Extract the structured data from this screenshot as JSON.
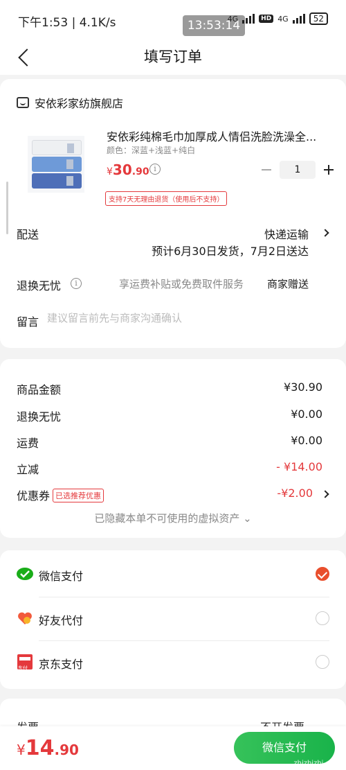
{
  "status_bar": {
    "time": "下午1:53 | 4.1K/s",
    "clock_overlay": "13:53:14",
    "network1": "4G",
    "hd": "HD",
    "network2": "4G",
    "battery": "52"
  },
  "nav": {
    "title": "填写订单"
  },
  "shop": {
    "name": "安依彩家纺旗舰店"
  },
  "product": {
    "title": "安依彩纯棉毛巾加厚成人情侣洗脸洗澡全...",
    "spec": "颜色：深蓝+浅蓝+纯白",
    "price_currency": "¥",
    "price_int": "30",
    "price_dec": ".90",
    "quantity": "1",
    "return_policy": "支持7天无理由退货（使用后不支持）"
  },
  "delivery": {
    "label": "配送",
    "method": "快递运输",
    "estimate": "预计6月30日发货，7月2日送达"
  },
  "hassle_free": {
    "label": "退换无忧",
    "description": "享运费补贴或免费取件服务",
    "gift": "商家赠送"
  },
  "remark": {
    "label": "留言",
    "placeholder": "建议留言前先与商家沟通确认"
  },
  "summary": {
    "goods_label": "商品金额",
    "goods_value": "¥30.90",
    "hassle_label": "退换无忧",
    "hassle_value": "¥0.00",
    "shipping_label": "运费",
    "shipping_value": "¥0.00",
    "discount_label": "立减",
    "discount_value": "- ¥14.00",
    "coupon_label": "优惠券",
    "coupon_badge": "已选推荐优惠",
    "coupon_value": "-¥2.00",
    "hidden_assets": "已隐藏本单不可使用的虚拟资产 ⌄"
  },
  "payment": {
    "options": [
      {
        "label": "微信支付",
        "selected": true
      },
      {
        "label": "好友代付",
        "selected": false
      },
      {
        "label": "京东支付",
        "selected": false
      }
    ],
    "jd_icon_text": "东付"
  },
  "invoice": {
    "label": "发票",
    "value": "不开发票"
  },
  "bottom": {
    "currency": "¥",
    "total_int": "14",
    "total_dec": ".90",
    "pay_button": "微信支付"
  },
  "watermark": "zhizhizhi.com",
  "colors": {
    "accent_red": "#e4393c",
    "wechat_green": "#1aad19",
    "radio_selected": "#e94f2d"
  }
}
